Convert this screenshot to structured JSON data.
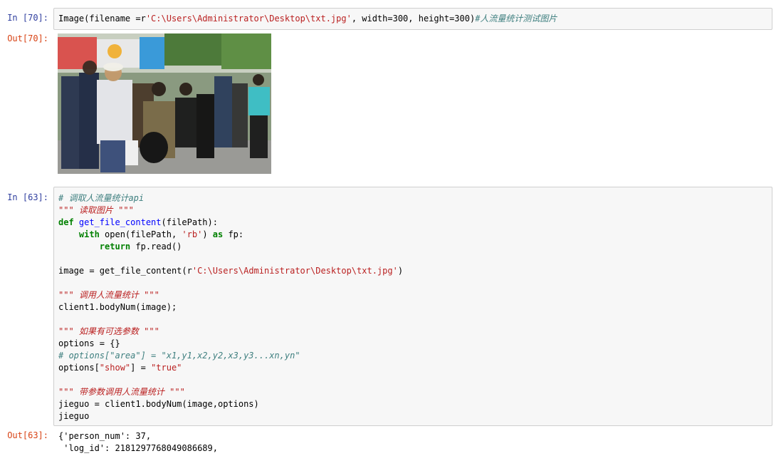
{
  "cell70": {
    "in_prompt": "In [70]:",
    "code_lines": [
      {
        "tokens": [
          {
            "t": "Image(filename =r",
            "c": ""
          },
          {
            "t": "'C:\\Users\\Administrator\\Desktop\\txt.jpg'",
            "c": "str"
          },
          {
            "t": ", width=300, height=300)",
            "c": ""
          },
          {
            "t": "#人流量统计测试图片",
            "c": "com"
          }
        ]
      }
    ],
    "out_prompt": "Out[70]:",
    "image_alt": "crowd of people queueing on a street"
  },
  "cell63": {
    "in_prompt": "In [63]:",
    "code_lines": [
      {
        "tokens": [
          {
            "t": "# 调取人流量统计api",
            "c": "com"
          }
        ]
      },
      {
        "tokens": [
          {
            "t": "\"\"\" 读取图片 \"\"\"",
            "c": "doc"
          }
        ]
      },
      {
        "tokens": [
          {
            "t": "def ",
            "c": "kw"
          },
          {
            "t": "get_file_content",
            "c": "fn"
          },
          {
            "t": "(filePath):",
            "c": ""
          }
        ]
      },
      {
        "tokens": [
          {
            "t": "    ",
            "c": ""
          },
          {
            "t": "with ",
            "c": "kw"
          },
          {
            "t": "open(filePath, ",
            "c": ""
          },
          {
            "t": "'rb'",
            "c": "str"
          },
          {
            "t": ") ",
            "c": ""
          },
          {
            "t": "as",
            "c": "kw"
          },
          {
            "t": " fp:",
            "c": ""
          }
        ]
      },
      {
        "tokens": [
          {
            "t": "        ",
            "c": ""
          },
          {
            "t": "return",
            "c": "kw"
          },
          {
            "t": " fp.read()",
            "c": ""
          }
        ]
      },
      {
        "tokens": [
          {
            "t": "",
            "c": ""
          }
        ]
      },
      {
        "tokens": [
          {
            "t": "image = get_file_content(r",
            "c": ""
          },
          {
            "t": "'C:\\Users\\Administrator\\Desktop\\txt.jpg'",
            "c": "str"
          },
          {
            "t": ")",
            "c": ""
          }
        ]
      },
      {
        "tokens": [
          {
            "t": "",
            "c": ""
          }
        ]
      },
      {
        "tokens": [
          {
            "t": "\"\"\" 调用人流量统计 \"\"\"",
            "c": "doc"
          }
        ]
      },
      {
        "tokens": [
          {
            "t": "client1.bodyNum(image);",
            "c": ""
          }
        ]
      },
      {
        "tokens": [
          {
            "t": "",
            "c": ""
          }
        ]
      },
      {
        "tokens": [
          {
            "t": "\"\"\" 如果有可选参数 \"\"\"",
            "c": "doc"
          }
        ]
      },
      {
        "tokens": [
          {
            "t": "options = {}",
            "c": ""
          }
        ]
      },
      {
        "tokens": [
          {
            "t": "# options[\"area\"] = \"x1,y1,x2,y2,x3,y3...xn,yn\"",
            "c": "com"
          }
        ]
      },
      {
        "tokens": [
          {
            "t": "options[",
            "c": ""
          },
          {
            "t": "\"show\"",
            "c": "str"
          },
          {
            "t": "] = ",
            "c": ""
          },
          {
            "t": "\"true\"",
            "c": "str"
          }
        ]
      },
      {
        "tokens": [
          {
            "t": "",
            "c": ""
          }
        ]
      },
      {
        "tokens": [
          {
            "t": "\"\"\" 带参数调用人流量统计 \"\"\"",
            "c": "doc"
          }
        ]
      },
      {
        "tokens": [
          {
            "t": "jieguo = client1.bodyNum(image,options)",
            "c": ""
          }
        ]
      },
      {
        "tokens": [
          {
            "t": "jieguo",
            "c": ""
          }
        ]
      }
    ],
    "out_prompt": "Out[63]:",
    "output_lines": [
      "{'person_num': 37,",
      " 'log_id': 2181297768049086689,"
    ]
  },
  "colors": {
    "in_prompt": "#303f9f",
    "out_prompt": "#d84315",
    "cell_bg": "#f7f7f7",
    "cell_border": "#cfcfcf"
  }
}
